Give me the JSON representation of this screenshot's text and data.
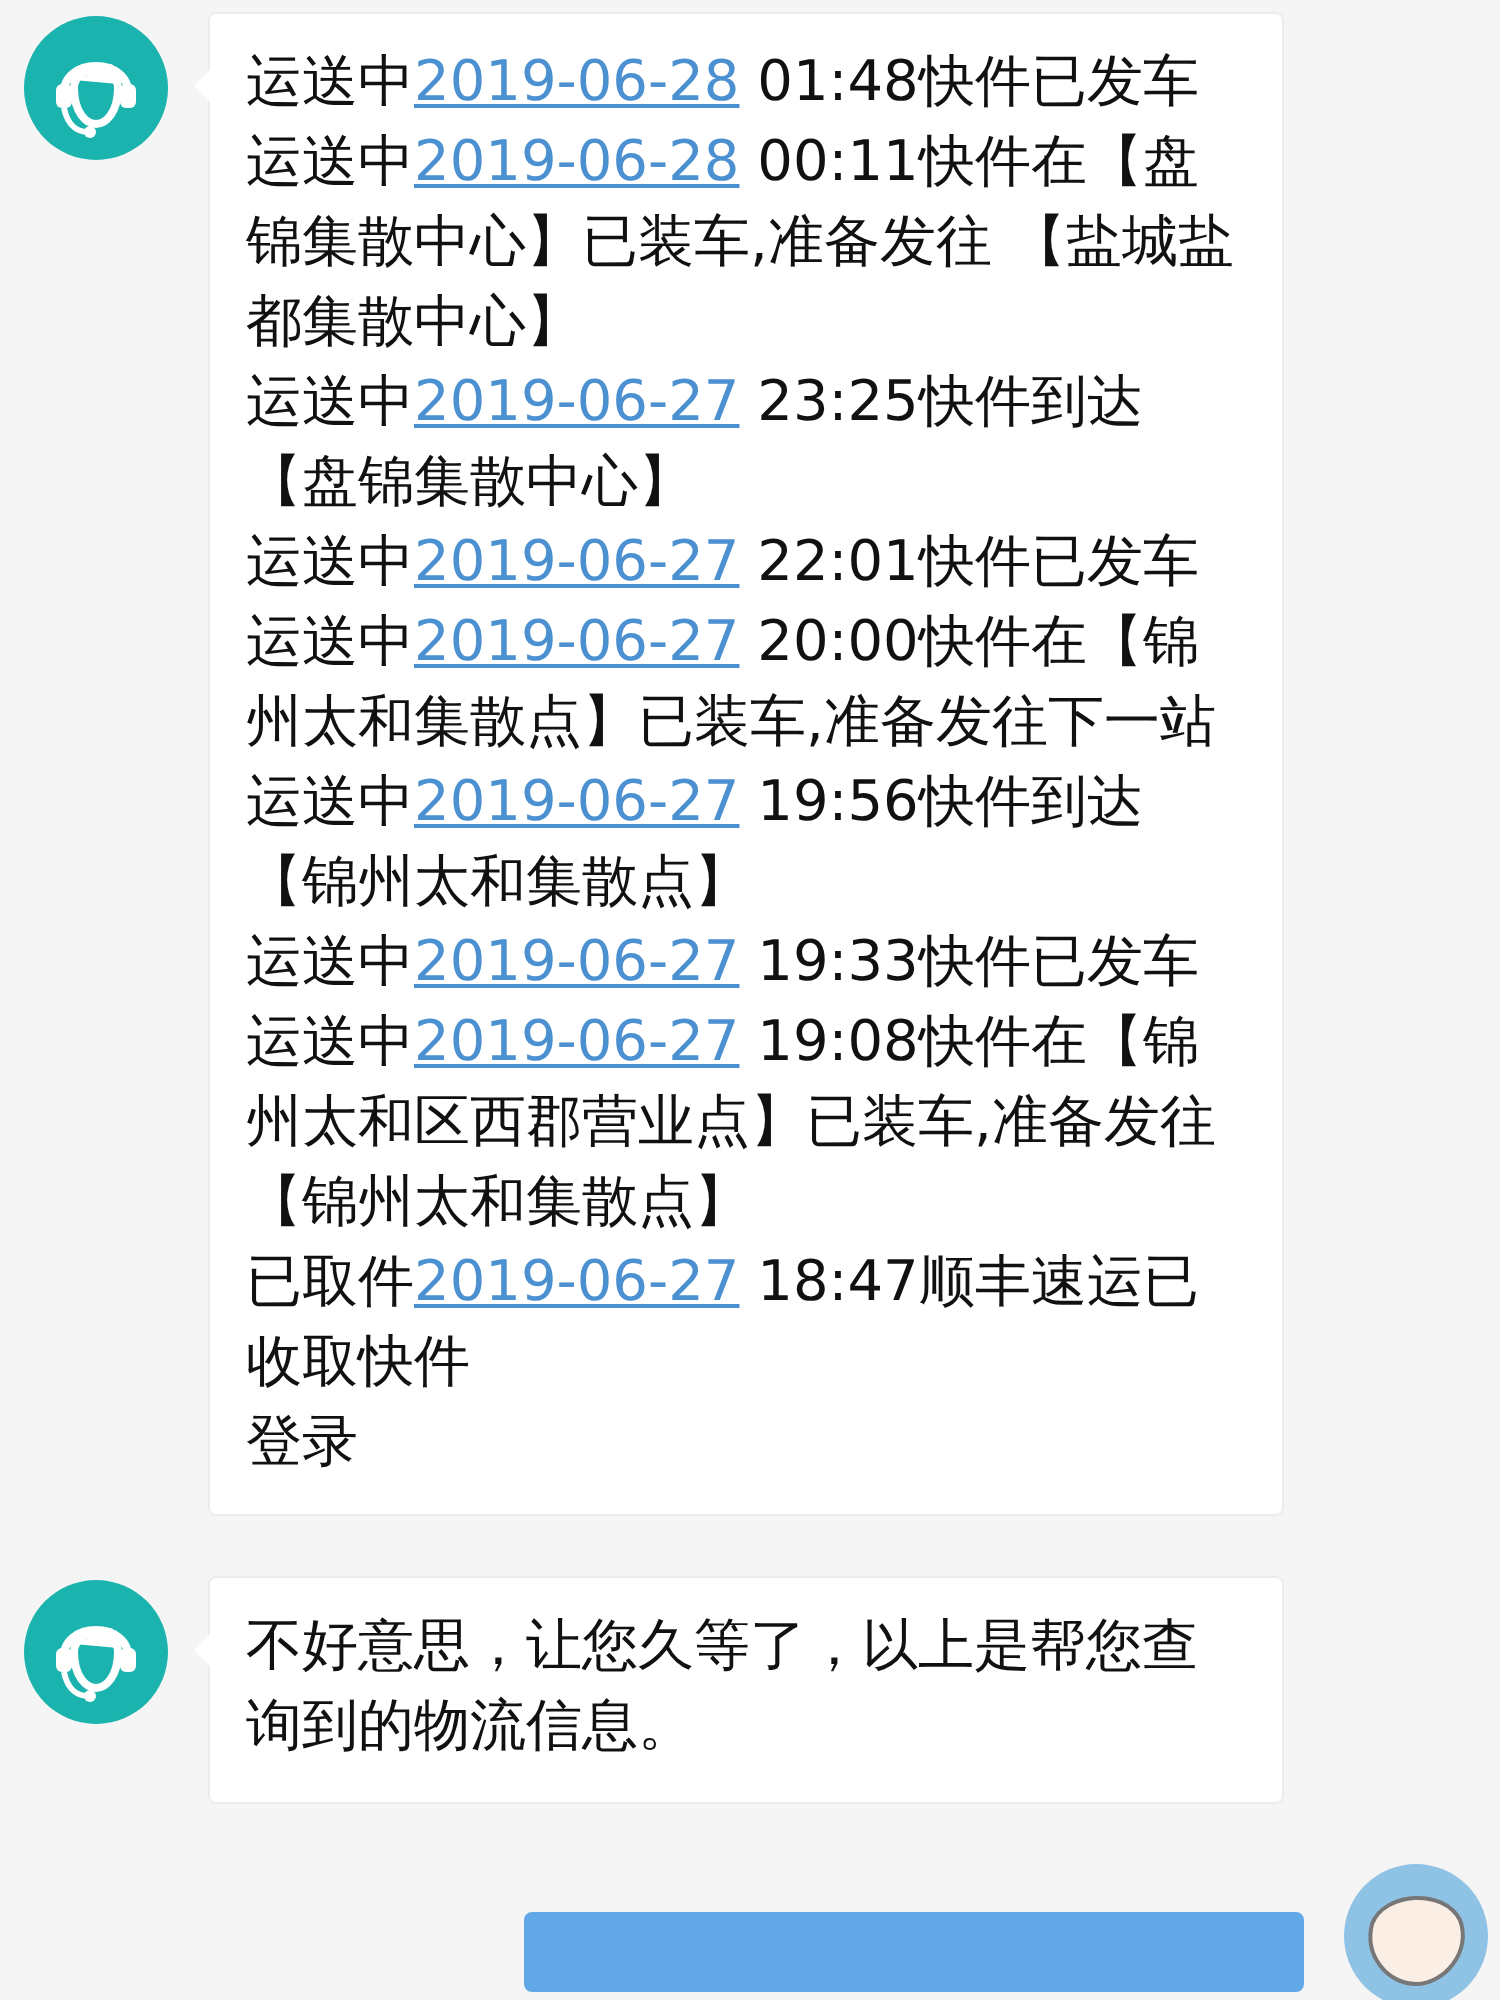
{
  "messages": [
    {
      "outgoing": false,
      "kind": "tracking",
      "entries": [
        {
          "status": "运送中",
          "date": "2019-06-28",
          "detail": " 01:48快件已发车"
        },
        {
          "status": "运送中",
          "date": "2019-06-28",
          "detail": " 00:11快件在【盘锦集散中心】已装车,准备发往 【盐城盐都集散中心】"
        },
        {
          "status": "运送中",
          "date": "2019-06-27",
          "detail": " 23:25快件到达【盘锦集散中心】"
        },
        {
          "status": "运送中",
          "date": "2019-06-27",
          "detail": " 22:01快件已发车"
        },
        {
          "status": "运送中",
          "date": "2019-06-27",
          "detail": " 20:00快件在【锦州太和集散点】已装车,准备发往下一站"
        },
        {
          "status": "运送中",
          "date": "2019-06-27",
          "detail": " 19:56快件到达【锦州太和集散点】"
        },
        {
          "status": "运送中",
          "date": "2019-06-27",
          "detail": " 19:33快件已发车"
        },
        {
          "status": "运送中",
          "date": "2019-06-27",
          "detail": " 19:08快件在【锦州太和区西郡营业点】已装车,准备发往【锦州太和集散点】"
        },
        {
          "status": "已取件",
          "date": "2019-06-27",
          "detail": " 18:47顺丰速运已收取快件"
        }
      ],
      "footer": "登录"
    },
    {
      "outgoing": false,
      "kind": "text",
      "text": "不好意思，让您久等了，以上是帮您查询到的物流信息。"
    },
    {
      "outgoing": true,
      "kind": "cut"
    }
  ]
}
